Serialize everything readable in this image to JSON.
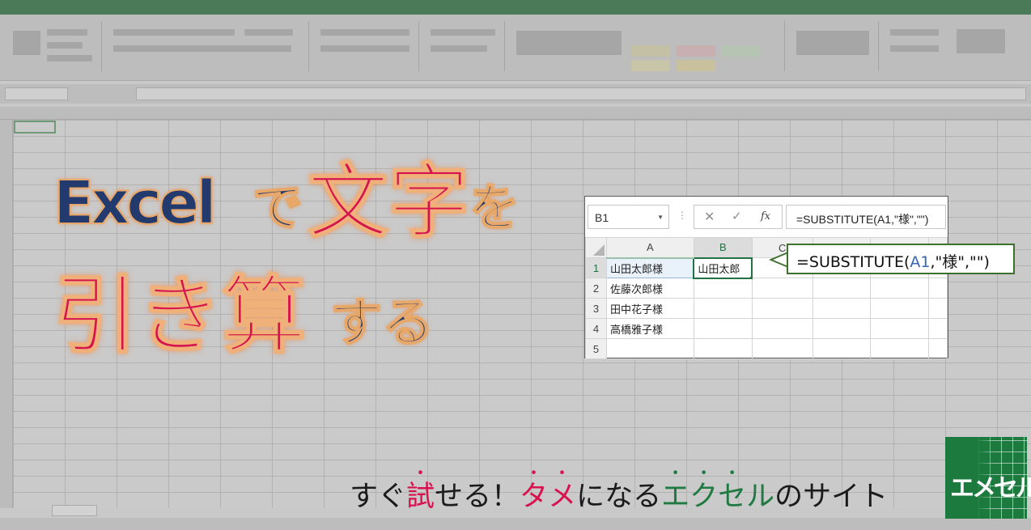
{
  "headline": {
    "excel": "Excel",
    "de": "で",
    "moji": "文字",
    "wo": "を",
    "hikizan": "引き算",
    "suru": "する"
  },
  "mini_excel": {
    "name_box": "B1",
    "formula_bar": "=SUBSTITUTE(A1,\"様\",\"\")",
    "fx_label": "fx",
    "cancel_icon": "x-icon",
    "enter_icon": "check-icon",
    "columns": [
      "A",
      "B",
      "C"
    ],
    "rows": [
      {
        "num": "1",
        "a": "山田太郎様",
        "b": "山田太郎"
      },
      {
        "num": "2",
        "a": "佐藤次郎様",
        "b": ""
      },
      {
        "num": "3",
        "a": "田中花子様",
        "b": ""
      },
      {
        "num": "4",
        "a": "高橋雅子様",
        "b": ""
      },
      {
        "num": "5",
        "a": "",
        "b": ""
      }
    ]
  },
  "callout": {
    "prefix": "=SUBSTITUTE(",
    "ref": "A1",
    "suffix": ",\"様\",\"\")"
  },
  "tagline": {
    "p1": "すぐ",
    "p2": "試",
    "p3": "せる！",
    "p4": "タ",
    "p5": "メ",
    "p6": "になる",
    "p7": "エ",
    "p8": "ク",
    "p9": "セ",
    "p10": "ル",
    "p11": "のサイト"
  },
  "logo": {
    "text": "エメセル"
  },
  "colors": {
    "headline_blue": "#233a6e",
    "headline_red": "#d5144f",
    "excel_green": "#217346",
    "tag_red": "#d7124e",
    "tag_green": "#1e7a40"
  }
}
